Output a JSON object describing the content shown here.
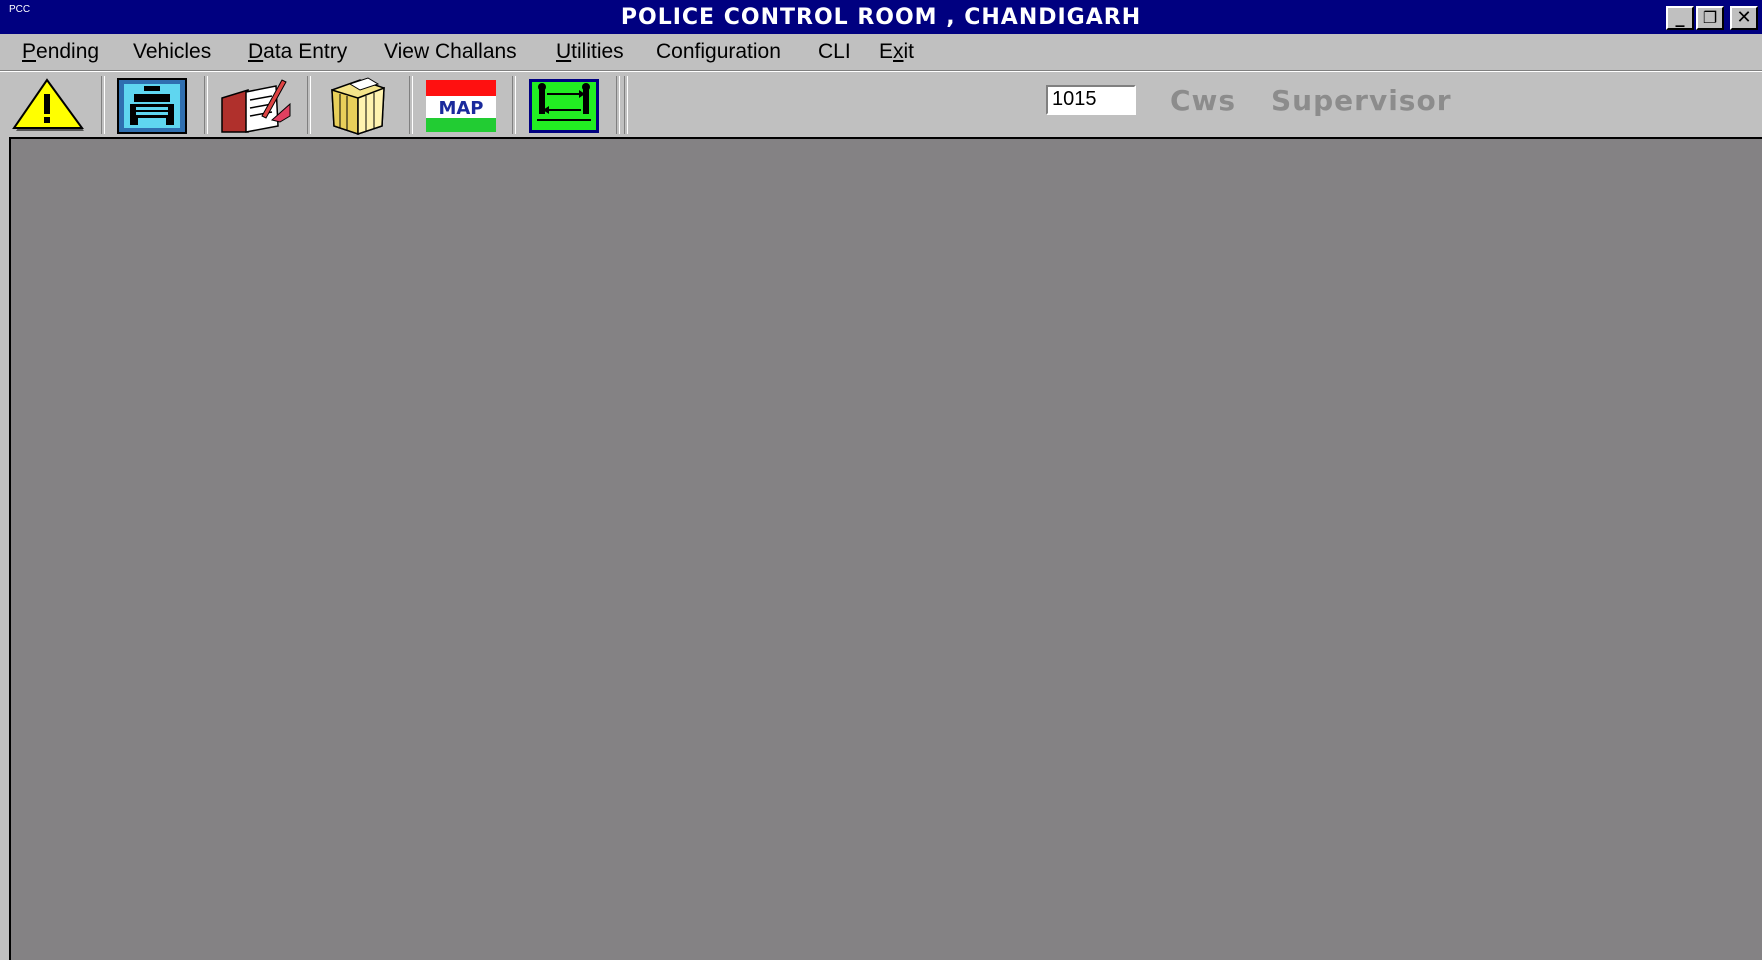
{
  "window": {
    "system_icon_label": "PCC",
    "title": "POLICE CONTROL ROOM , CHANDIGARH",
    "controls": {
      "minimize": "_",
      "restore": "❐",
      "close": "✕"
    }
  },
  "menu": [
    {
      "label": "Pending",
      "mnemonic": "P"
    },
    {
      "label": "Vehicles",
      "mnemonic": ""
    },
    {
      "label": "Data Entry",
      "mnemonic": "D"
    },
    {
      "label": "View Challans",
      "mnemonic": ""
    },
    {
      "label": "Utilities",
      "mnemonic": "U"
    },
    {
      "label": "Configuration",
      "mnemonic": ""
    },
    {
      "label": "CLI",
      "mnemonic": ""
    },
    {
      "label": "Exit",
      "mnemonic": "x"
    }
  ],
  "toolbar": {
    "buttons": [
      {
        "icon": "warning-icon"
      },
      {
        "icon": "vehicle-icon"
      },
      {
        "icon": "data-entry-icon"
      },
      {
        "icon": "files-icon"
      },
      {
        "icon": "map-icon",
        "text": "MAP"
      },
      {
        "icon": "transfer-icon"
      }
    ],
    "id_value": "1015",
    "role_primary": "Cws",
    "role_secondary": "Supervisor"
  },
  "colors": {
    "titlebar": "#000080",
    "client_background": "#848284",
    "chrome": "#c0c0c0",
    "role_text": "#8c8c8c"
  }
}
